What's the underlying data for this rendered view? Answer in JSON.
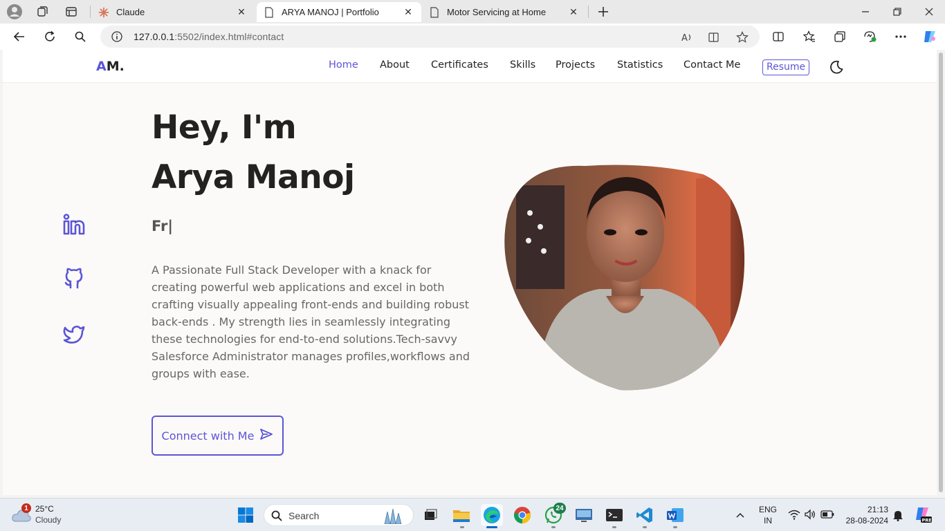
{
  "browser": {
    "tabs": [
      {
        "title": "Claude",
        "active": false
      },
      {
        "title": "ARYA MANOJ | Portfolio",
        "active": true
      },
      {
        "title": "Motor Servicing at Home",
        "active": false
      }
    ],
    "url_host": "127.0.0.1",
    "url_rest": ":5502/index.html#contact"
  },
  "site": {
    "logo_accent": "A",
    "logo_rest": "M.",
    "nav": [
      "Home",
      "About",
      "Certificates",
      "Skills",
      "Projects",
      "Statistics",
      "Contact Me"
    ],
    "active_nav": "Home",
    "resume_label": "Resume",
    "colors": {
      "accent": "#5b55d6",
      "page_bg": "#fcfaf9"
    }
  },
  "hero": {
    "greeting": "Hey, I'm",
    "name": "Arya Manoj",
    "typed_text": "Fr|",
    "bio": "A Passionate Full Stack Developer with a knack for creating powerful web applications and excel in both crafting visually appealing front-ends and building robust back-ends . My strength lies in seamlessly integrating these technologies for end-to-end solutions.Tech-savvy Salesforce Administrator manages profiles,workflows and groups with ease.",
    "cta_label": "Connect with Me",
    "socials": [
      "linkedin-icon",
      "github-icon",
      "twitter-icon"
    ]
  },
  "taskbar": {
    "weather_temp": "25°C",
    "weather_cond": "Cloudy",
    "weather_badge": "1",
    "search_label": "Search",
    "whatsapp_badge": "24",
    "lang_top": "ENG",
    "lang_bottom": "IN",
    "time": "21:13",
    "date": "28-08-2024"
  }
}
